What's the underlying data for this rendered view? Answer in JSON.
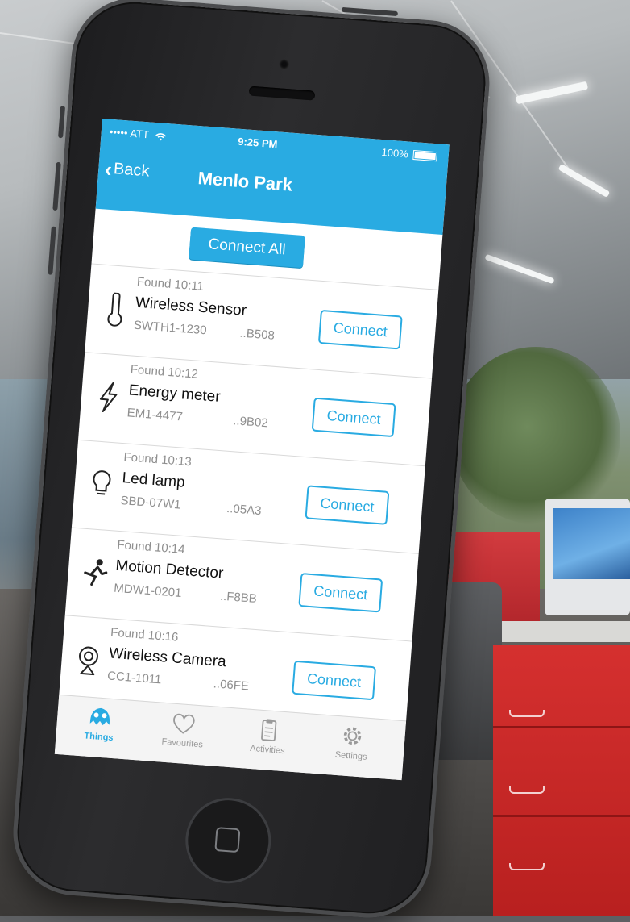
{
  "status_bar": {
    "carrier": "••••• ATT",
    "time": "9:25 PM",
    "battery": "100%"
  },
  "nav": {
    "back_label": "Back",
    "title": "Menlo Park"
  },
  "connect_all_label": "Connect All",
  "devices": [
    {
      "found": "Found 10:11",
      "name": "Wireless Sensor",
      "model": "SWTH1-1230",
      "mac": "..B508",
      "icon": "thermometer-icon",
      "button": "Connect"
    },
    {
      "found": "Found 10:12",
      "name": "Energy meter",
      "model": "EM1-4477",
      "mac": "..9B02",
      "icon": "lightning-icon",
      "button": "Connect"
    },
    {
      "found": "Found 10:13",
      "name": "Led lamp",
      "model": "SBD-07W1",
      "mac": "..05A3",
      "icon": "lightbulb-icon",
      "button": "Connect"
    },
    {
      "found": "Found 10:14",
      "name": "Motion Detector",
      "model": "MDW1-0201",
      "mac": "..F8BB",
      "icon": "running-person-icon",
      "button": "Connect"
    },
    {
      "found": "Found 10:16",
      "name": "Wireless Camera",
      "model": "CC1-1011",
      "mac": "..06FE",
      "icon": "webcam-icon",
      "button": "Connect"
    }
  ],
  "tabs": [
    {
      "label": "Things",
      "icon": "things-robot-icon",
      "active": true
    },
    {
      "label": "Favourites",
      "icon": "heart-icon",
      "active": false
    },
    {
      "label": "Activities",
      "icon": "clipboard-icon",
      "active": false
    },
    {
      "label": "Settings",
      "icon": "gear-icon",
      "active": false
    }
  ],
  "colors": {
    "accent": "#29abe2",
    "background": "#ffffff"
  }
}
